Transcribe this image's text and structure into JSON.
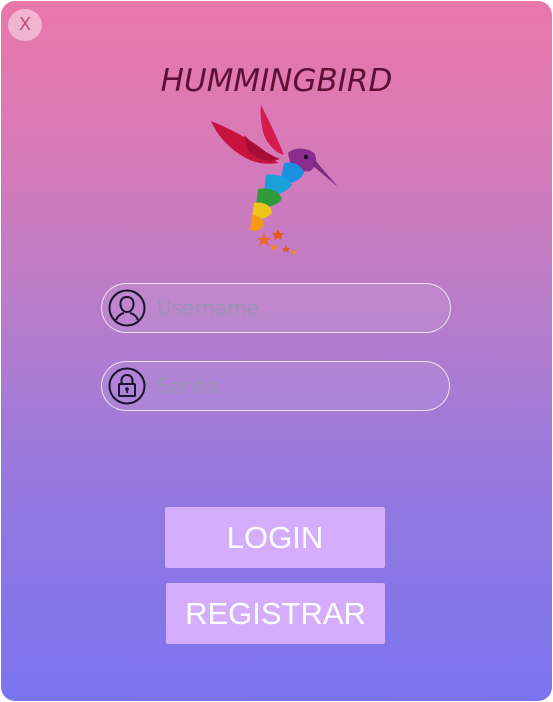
{
  "window": {
    "close_label": "X"
  },
  "app": {
    "title": "HUMMINGBIRD",
    "logo_icon": "hummingbird-logo-icon"
  },
  "form": {
    "username": {
      "placeholder": "Username",
      "value": "",
      "icon": "user-icon"
    },
    "password": {
      "placeholder": "Senha",
      "value": "",
      "icon": "lock-icon"
    }
  },
  "buttons": {
    "login_label": "LOGIN",
    "register_label": "REGISTRAR"
  },
  "colors": {
    "gradient_top": "#e977a9",
    "gradient_bottom": "#7b74ef",
    "button_bg": "#d5adfd",
    "title_color": "#5e0f36"
  }
}
